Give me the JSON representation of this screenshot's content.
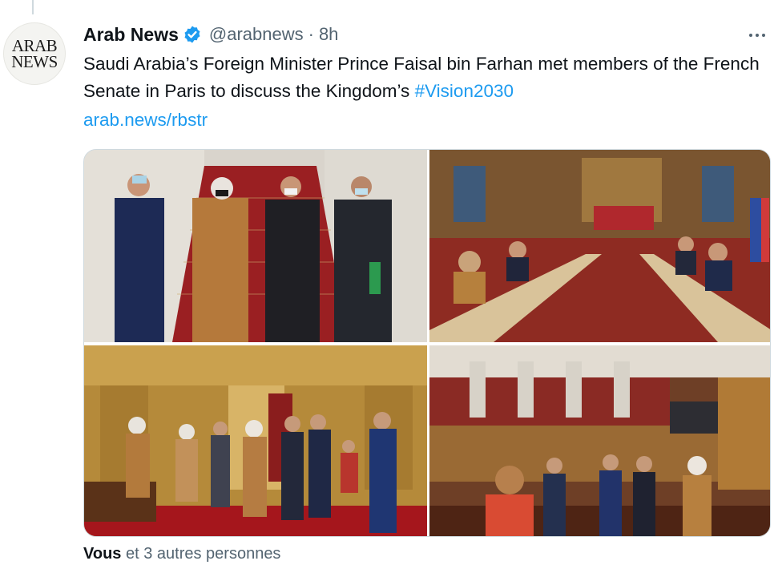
{
  "tweet": {
    "avatar_text_line1": "ARAB",
    "avatar_text_line2": "NEWS",
    "author_name": "Arab News",
    "handle": "@arabnews",
    "separator": "·",
    "time": "8h",
    "text_main": "Saudi Arabia’s Foreign Minister Prince Faisal bin Farhan met members of the French Senate in Paris to discuss the Kingdom’s ",
    "hashtag": "#Vision2030",
    "link": "arab.news/rbstr",
    "likes_strong": "Vous",
    "likes_rest": " et 3 autres personnes"
  },
  "icons": {
    "verified": "verified-badge-icon",
    "more": "more-options-icon"
  },
  "colors": {
    "link": "#1d9bf0",
    "verified": "#1d9bf0",
    "secondary_text": "#536471",
    "primary_text": "#0f1419"
  },
  "media": {
    "photos": [
      {
        "id": "photo-staircase-group"
      },
      {
        "id": "photo-senate-meeting-room"
      },
      {
        "id": "photo-gilded-hall"
      },
      {
        "id": "photo-senate-chamber"
      }
    ]
  }
}
